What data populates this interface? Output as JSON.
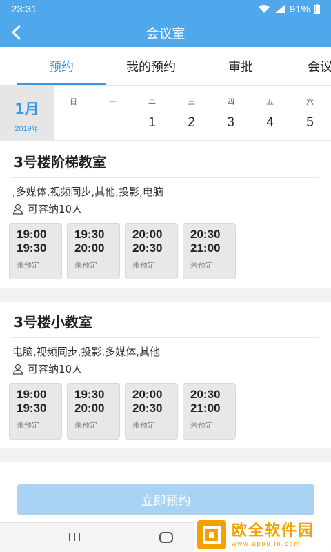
{
  "status_bar": {
    "time": "23:31",
    "battery": "91%"
  },
  "app_bar": {
    "title": "会议室"
  },
  "tabs": [
    {
      "label": "预约",
      "active": true
    },
    {
      "label": "我的预约",
      "active": false
    },
    {
      "label": "审批",
      "active": false
    },
    {
      "label": "会议",
      "active": false
    }
  ],
  "calendar": {
    "month": "1月",
    "year": "2019年",
    "days": [
      {
        "weekday": "日",
        "date": ""
      },
      {
        "weekday": "一",
        "date": ""
      },
      {
        "weekday": "二",
        "date": "1"
      },
      {
        "weekday": "三",
        "date": "2"
      },
      {
        "weekday": "四",
        "date": "3"
      },
      {
        "weekday": "五",
        "date": "4"
      },
      {
        "weekday": "六",
        "date": "5"
      }
    ]
  },
  "rooms": [
    {
      "name": "3号楼阶梯教室",
      "features": ",多媒体,视频同步,其他,投影,电脑",
      "capacity": "可容纳10人",
      "slots": [
        {
          "start": "19:00",
          "end": "19:30",
          "status": "未预定"
        },
        {
          "start": "19:30",
          "end": "20:00",
          "status": "未预定"
        },
        {
          "start": "20:00",
          "end": "20:30",
          "status": "未预定"
        },
        {
          "start": "20:30",
          "end": "21:00",
          "status": "未预定"
        }
      ]
    },
    {
      "name": "3号楼小教室",
      "features": "电脑,视频同步,投影,多媒体,其他",
      "capacity": "可容纳10人",
      "slots": [
        {
          "start": "19:00",
          "end": "19:30",
          "status": "未预定"
        },
        {
          "start": "19:30",
          "end": "20:00",
          "status": "未预定"
        },
        {
          "start": "20:00",
          "end": "20:30",
          "status": "未预定"
        },
        {
          "start": "20:30",
          "end": "21:00",
          "status": "未预定"
        }
      ]
    }
  ],
  "book_button": "立即预约",
  "watermark": {
    "cn": "欧全软件园",
    "en": "www.apoujin.com"
  },
  "colors": {
    "accent": "#4fa8ec",
    "tab_active": "#3a97e0",
    "button_disabled": "#a9d3f5"
  }
}
